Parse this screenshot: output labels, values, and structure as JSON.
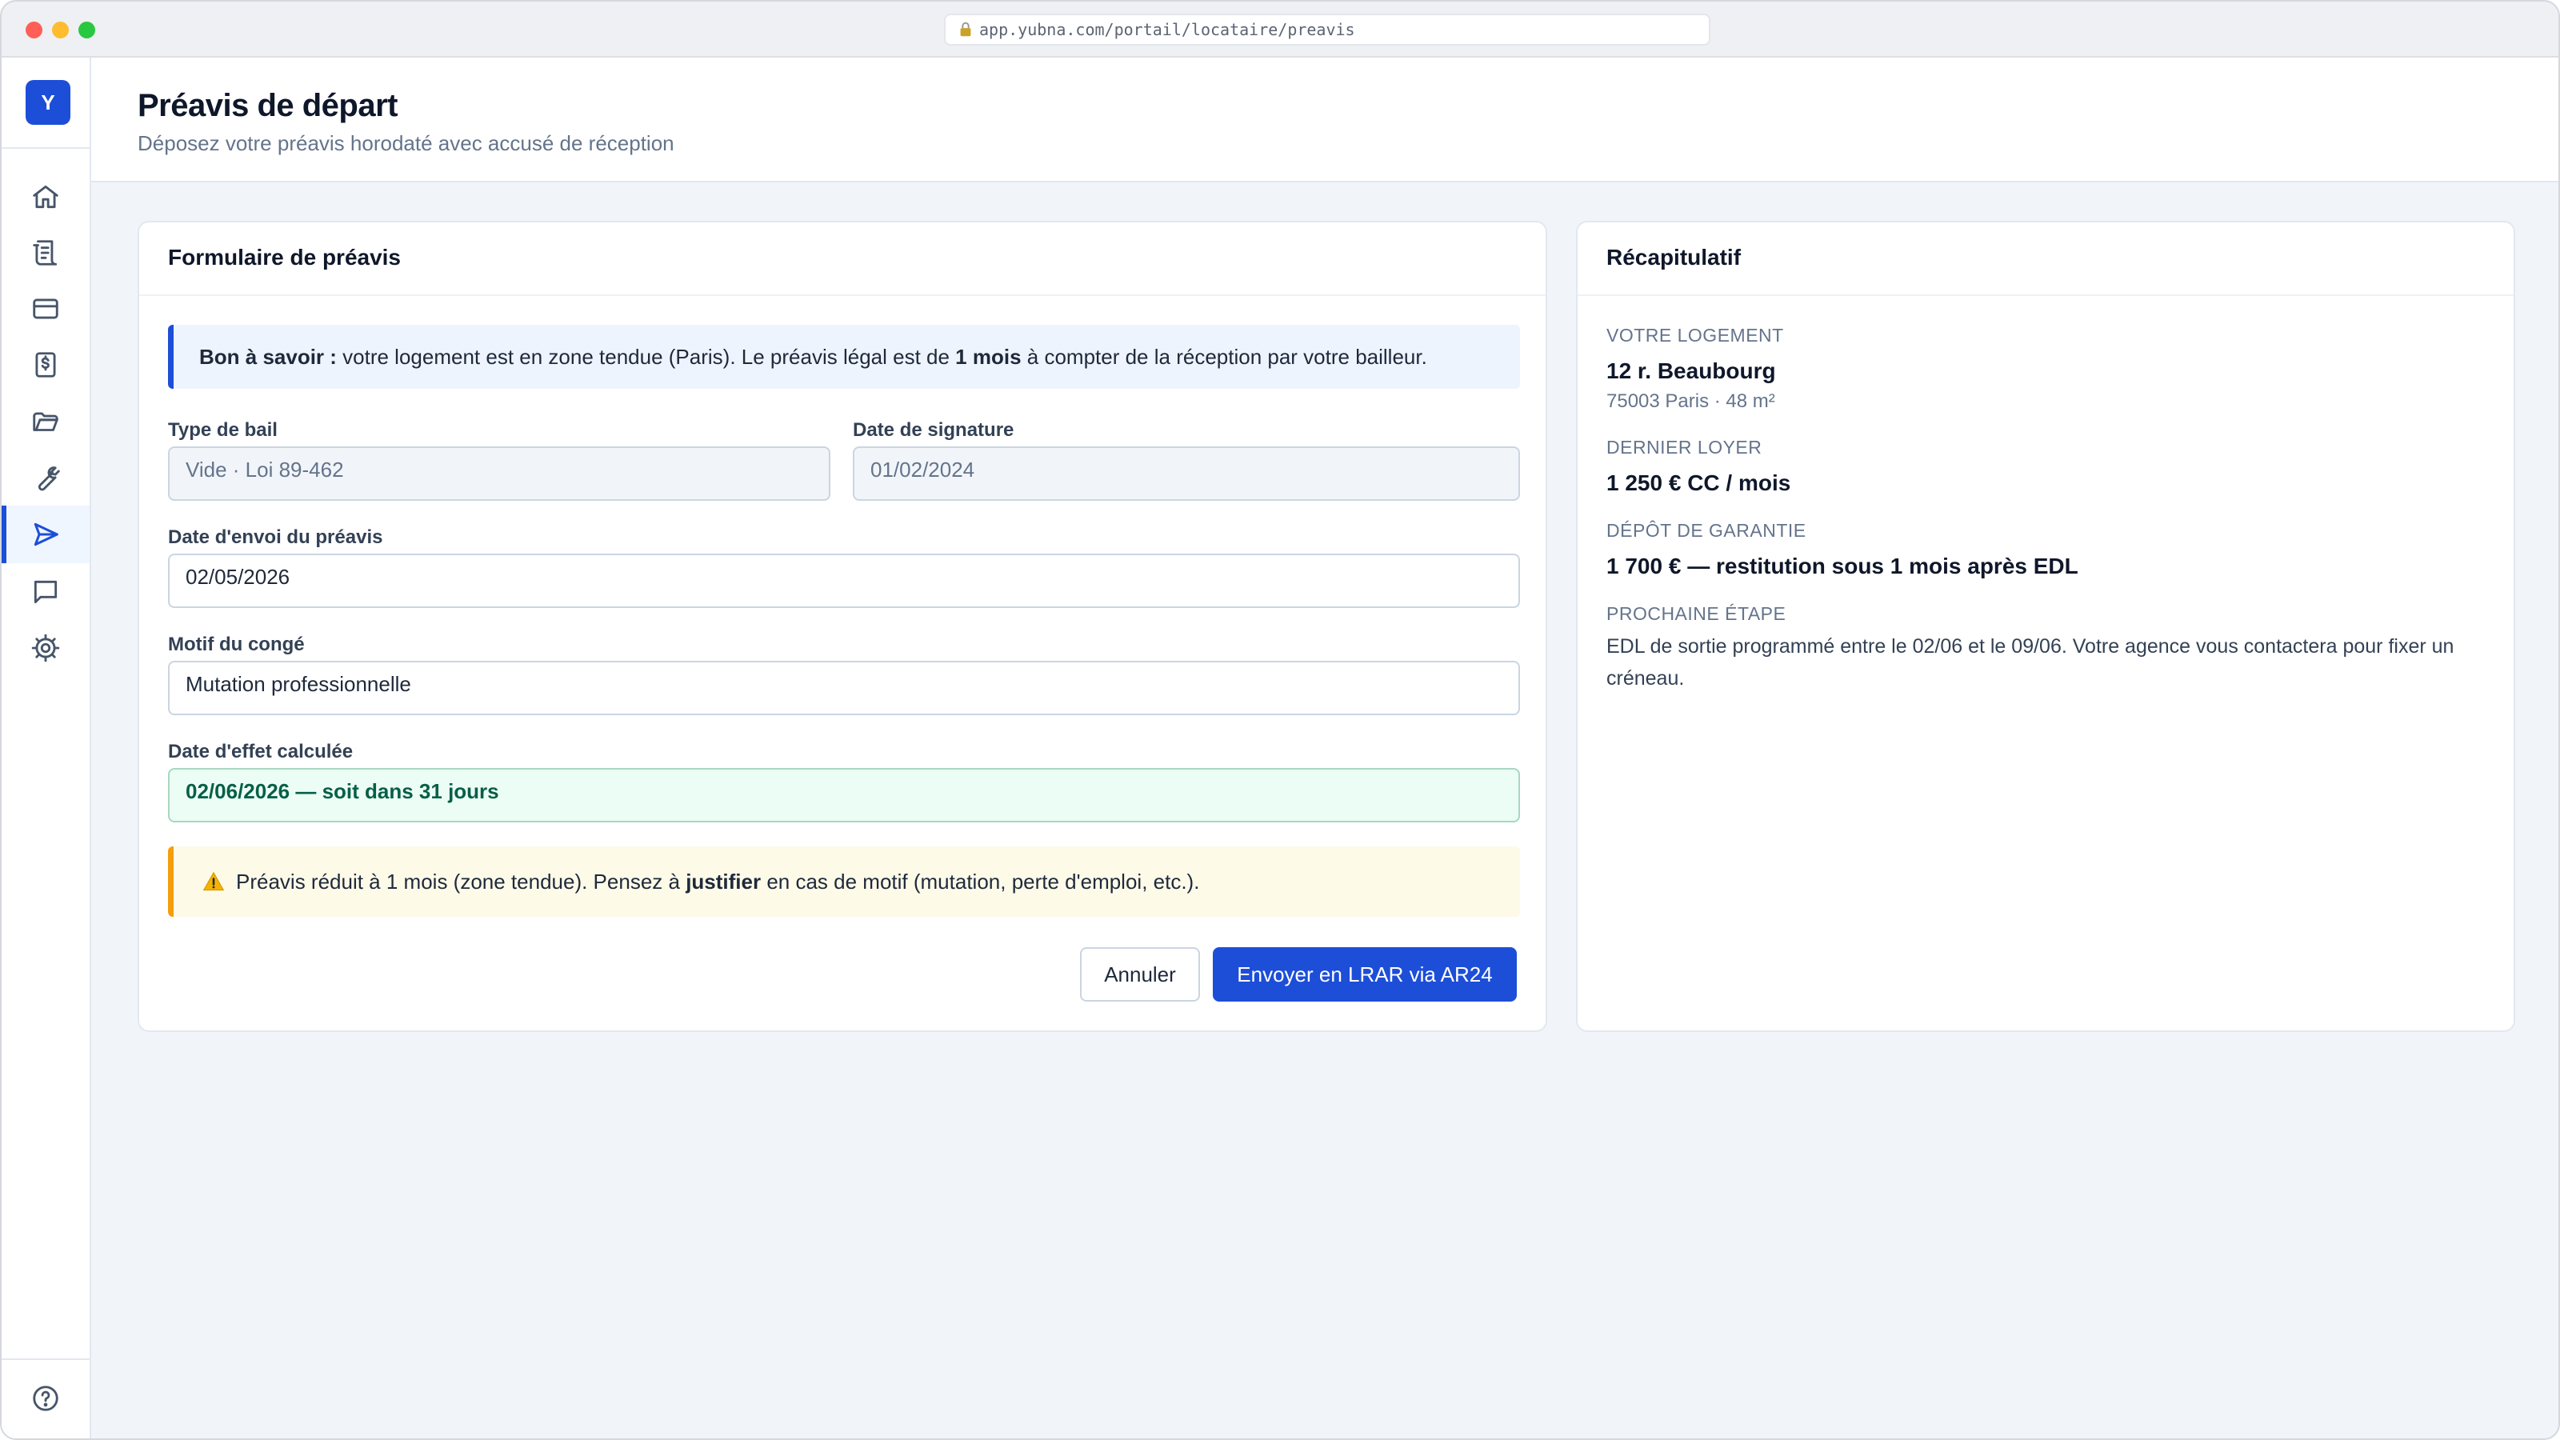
{
  "browser": {
    "url": "app.yubna.com/portail/locataire/preavis"
  },
  "sidebar": {
    "logo_letter": "Y",
    "items": [
      {
        "icon": "home-icon"
      },
      {
        "icon": "document-list-icon"
      },
      {
        "icon": "credit-card-icon"
      },
      {
        "icon": "receipt-icon"
      },
      {
        "icon": "folder-icon"
      },
      {
        "icon": "wrench-icon"
      },
      {
        "icon": "send-icon",
        "active": true
      },
      {
        "icon": "chat-icon"
      },
      {
        "icon": "gear-icon"
      }
    ],
    "bottom_icon": "help-icon"
  },
  "header": {
    "title": "Préavis de départ",
    "subtitle": "Déposez votre préavis horodaté avec accusé de réception"
  },
  "form": {
    "title": "Formulaire de préavis",
    "info": {
      "strong": "Bon à savoir :",
      "text_before": " votre logement est en zone tendue (Paris). Le préavis légal est de ",
      "highlight": "1 mois",
      "text_after": " à compter de la réception par votre bailleur."
    },
    "lease_type": {
      "label": "Type de bail",
      "value": "Vide · Loi 89-462"
    },
    "signature_date": {
      "label": "Date de signature",
      "value": "01/02/2024"
    },
    "send_date": {
      "label": "Date d'envoi du préavis",
      "value": "02/05/2026"
    },
    "reason": {
      "label": "Motif du congé",
      "value": "Mutation professionnelle"
    },
    "effective_date": {
      "label": "Date d'effet calculée",
      "value": "02/06/2026 — soit dans 31 jours"
    },
    "warning": {
      "icon": "warning-icon",
      "text_before": "Préavis réduit à 1 mois (zone tendue). Pensez à ",
      "strong": "justifier",
      "text_after": " en cas de motif (mutation, perte d'emploi, etc.)."
    },
    "cancel_label": "Annuler",
    "submit_label": "Envoyer en LRAR via AR24"
  },
  "recap": {
    "title": "Récapitulatif",
    "housing_label": "Votre logement",
    "housing_address": "12 r. Beaubourg",
    "housing_details": "75003 Paris · 48 m²",
    "rent_label": "Dernier loyer",
    "rent_value": "1 250 € CC / mois",
    "deposit_label": "Dépôt de garantie",
    "deposit_value": "1 700 € — restitution sous 1 mois après EDL",
    "next_step_label": "Prochaine étape",
    "next_step_text": "EDL de sortie programmé entre le 02/06 et le 09/06. Votre agence vous contactera pour fixer un créneau."
  },
  "colors": {
    "accent": "#1d4ed8",
    "info_bg": "#eef4fd",
    "success_bg": "#ecfdf5",
    "success_text": "#065f46",
    "warning_bg": "#fefae8",
    "warning_border": "#f59e0b"
  }
}
